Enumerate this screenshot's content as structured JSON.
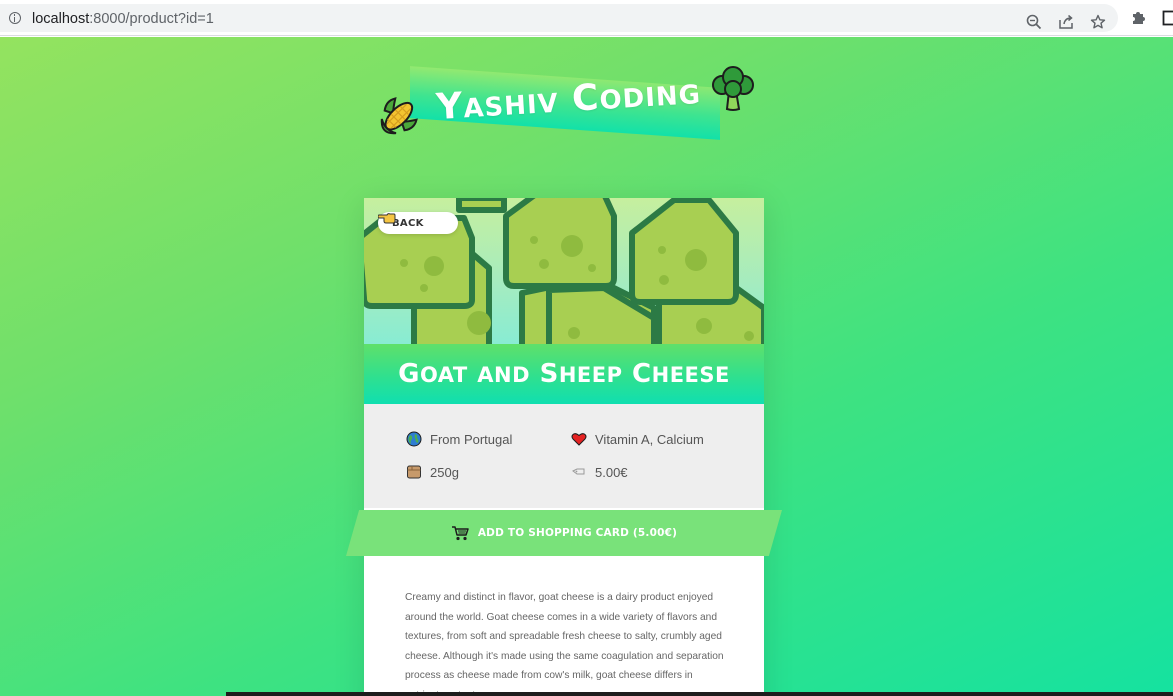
{
  "browser": {
    "url_host": "localhost",
    "url_rest": ":8000/product?id=1"
  },
  "logo": {
    "first_big": "Y",
    "first_small": "ASHIV",
    "second_big": "C",
    "second_small": "ODING"
  },
  "back_button": {
    "label": "BACK"
  },
  "product": {
    "title_parts": [
      {
        "big": "G",
        "small": "OAT"
      },
      {
        "big": " ",
        "small": "AND"
      },
      {
        "big": " S",
        "small": "HEEP"
      },
      {
        "big": " C",
        "small": "HEESE"
      }
    ],
    "origin": "From Portugal",
    "nutrients": "Vitamin A, Calcium",
    "weight": "250g",
    "price": "5.00€",
    "add_button_label": "ADD TO SHOPPING CARD (5.00€)",
    "description": "Creamy and distinct in flavor, goat cheese is a dairy product enjoyed around the world. Goat cheese comes in a wide variety of flavors and textures, from soft and spreadable fresh cheese to salty, crumbly aged cheese. Although it's made using the same coagulation and separation process as cheese made from cow's milk, goat cheese differs in nutrient content."
  },
  "colors": {
    "bg_start": "#94e35f",
    "bg_end": "#15e2a0",
    "cheese_fill": "#a8cf52",
    "cheese_outline": "#2c7a45",
    "button": "#79e27a"
  },
  "icons": {
    "logo_left": "corn-icon",
    "logo_right": "broccoli-icon",
    "back": "pointing-hand-icon",
    "origin": "globe-icon",
    "nutrients": "heart-icon",
    "weight": "package-icon",
    "price": "price-tag-icon",
    "add": "shopping-cart-icon"
  }
}
